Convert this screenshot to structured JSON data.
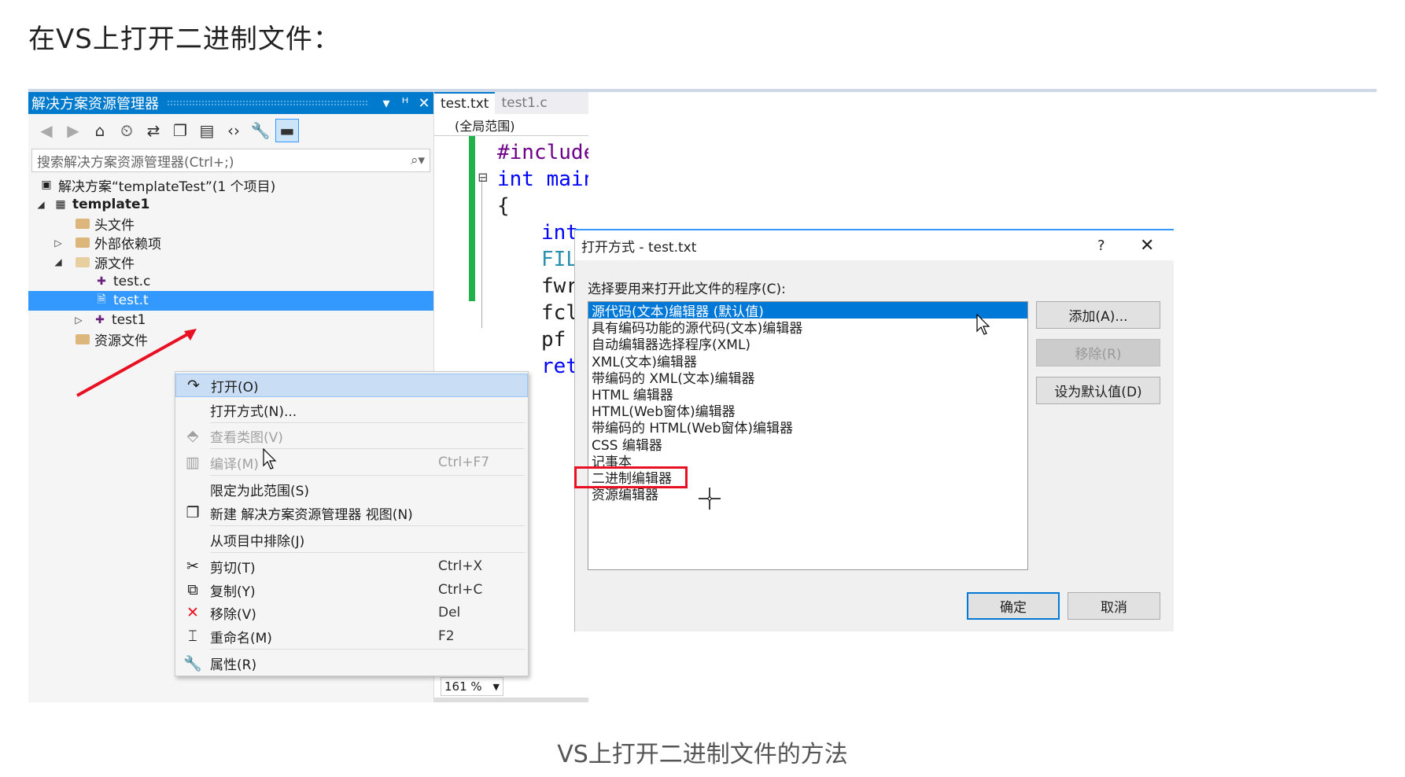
{
  "heading": "在VS上打开二进制文件：",
  "caption": "VS上打开二进制文件的方法",
  "solution_explorer": {
    "title": "解决方案资源管理器",
    "title_buttons": [
      "▾",
      "ᵸ",
      "✕"
    ],
    "search_placeholder": "搜索解决方案资源管理器(Ctrl+;)",
    "items": [
      {
        "label": "解决方案“templateTest”(1 个项目)"
      },
      {
        "label": "template1"
      },
      {
        "label": "头文件"
      },
      {
        "label": "外部依赖项"
      },
      {
        "label": "源文件"
      },
      {
        "label": "test.c"
      },
      {
        "label": "test.t"
      },
      {
        "label": "test1"
      },
      {
        "label": "资源文件"
      }
    ]
  },
  "editor": {
    "tabs": [
      "test.txt",
      "test1.c"
    ],
    "scope": "(全局范围)",
    "code_lines": [
      "#include",
      "int main",
      "{",
      "int",
      "FILE",
      "fwri",
      "fclo",
      "pf =",
      "retu"
    ],
    "zoom": "161 %"
  },
  "context_menu": {
    "items": [
      {
        "label": "打开(O)",
        "shortcut": ""
      },
      {
        "label": "打开方式(N)...",
        "shortcut": ""
      },
      {
        "label": "查看类图(V)",
        "shortcut": ""
      },
      {
        "label": "编译(M)",
        "shortcut": "Ctrl+F7"
      },
      {
        "label": "限定为此范围(S)",
        "shortcut": ""
      },
      {
        "label": "新建 解决方案资源管理器 视图(N)",
        "shortcut": ""
      },
      {
        "label": "从项目中排除(J)",
        "shortcut": ""
      },
      {
        "label": "剪切(T)",
        "shortcut": "Ctrl+X"
      },
      {
        "label": "复制(Y)",
        "shortcut": "Ctrl+C"
      },
      {
        "label": "移除(V)",
        "shortcut": "Del"
      },
      {
        "label": "重命名(M)",
        "shortcut": "F2"
      },
      {
        "label": "属性(R)",
        "shortcut": ""
      }
    ]
  },
  "dialog": {
    "title": "打开方式 - test.txt",
    "help": "?",
    "close": "✕",
    "prompt": "选择要用来打开此文件的程序(C):",
    "programs": [
      "源代码(文本)编辑器 (默认值)",
      "具有编码功能的源代码(文本)编辑器",
      "自动编辑器选择程序(XML)",
      "XML(文本)编辑器",
      "带编码的 XML(文本)编辑器",
      "HTML 编辑器",
      "HTML(Web窗体)编辑器",
      "带编码的 HTML(Web窗体)编辑器",
      "CSS 编辑器",
      "记事本",
      "二进制编辑器",
      "资源编辑器"
    ],
    "selected_index": 0,
    "buttons": {
      "add": "添加(A)...",
      "remove": "移除(R)",
      "set_default": "设为默认值(D)",
      "ok": "确定",
      "cancel": "取消"
    }
  },
  "colors": {
    "accent": "#007acc",
    "highlight_box": "#e81123",
    "arrow": "#e81123",
    "gutter_green": "#22b14c",
    "selection": "#3399ff"
  }
}
